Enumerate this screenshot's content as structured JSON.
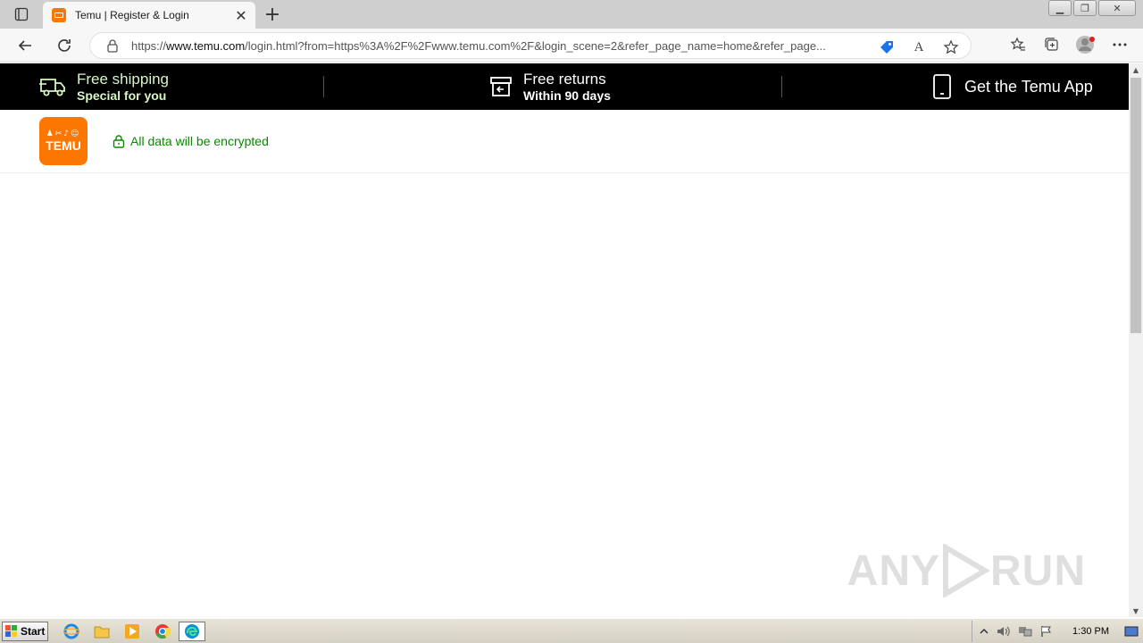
{
  "browser": {
    "tab_title": "Temu | Register & Login",
    "tab_close": "✕",
    "new_tab": "+",
    "url_prefix": "https://",
    "url_host": "www.temu.com",
    "url_rest": "/login.html?from=https%3A%2F%2Fwww.temu.com%2F&login_scene=2&refer_page_name=home&refer_page...",
    "read_aloud": "A",
    "colors": {
      "tab_strip": "#cfcfcf",
      "toolbar": "#f7f7f7"
    }
  },
  "promo_bar": {
    "shipping": {
      "title": "Free shipping",
      "subtitle": "Special for you",
      "icon": "truck-icon"
    },
    "returns": {
      "title": "Free returns",
      "subtitle": "Within 90 days",
      "icon": "return-box-icon"
    },
    "app": {
      "label": "Get the Temu App",
      "icon": "phone-icon"
    },
    "colors": {
      "background": "#000000",
      "highlight": "#d7f6c6"
    }
  },
  "header": {
    "logo_glyphs": "♟✂♪☺",
    "logo_text": "TEMU",
    "secure_text": "All data will be encrypted",
    "colors": {
      "brand": "#fb7701",
      "secure": "#0a8800"
    }
  },
  "watermark": {
    "left": "ANY",
    "right": "RUN"
  },
  "taskbar": {
    "start_label": "Start",
    "clock": "1:30 PM",
    "apps": [
      "ie-icon",
      "folder-icon",
      "media-player-icon",
      "chrome-icon",
      "edge-icon"
    ]
  }
}
